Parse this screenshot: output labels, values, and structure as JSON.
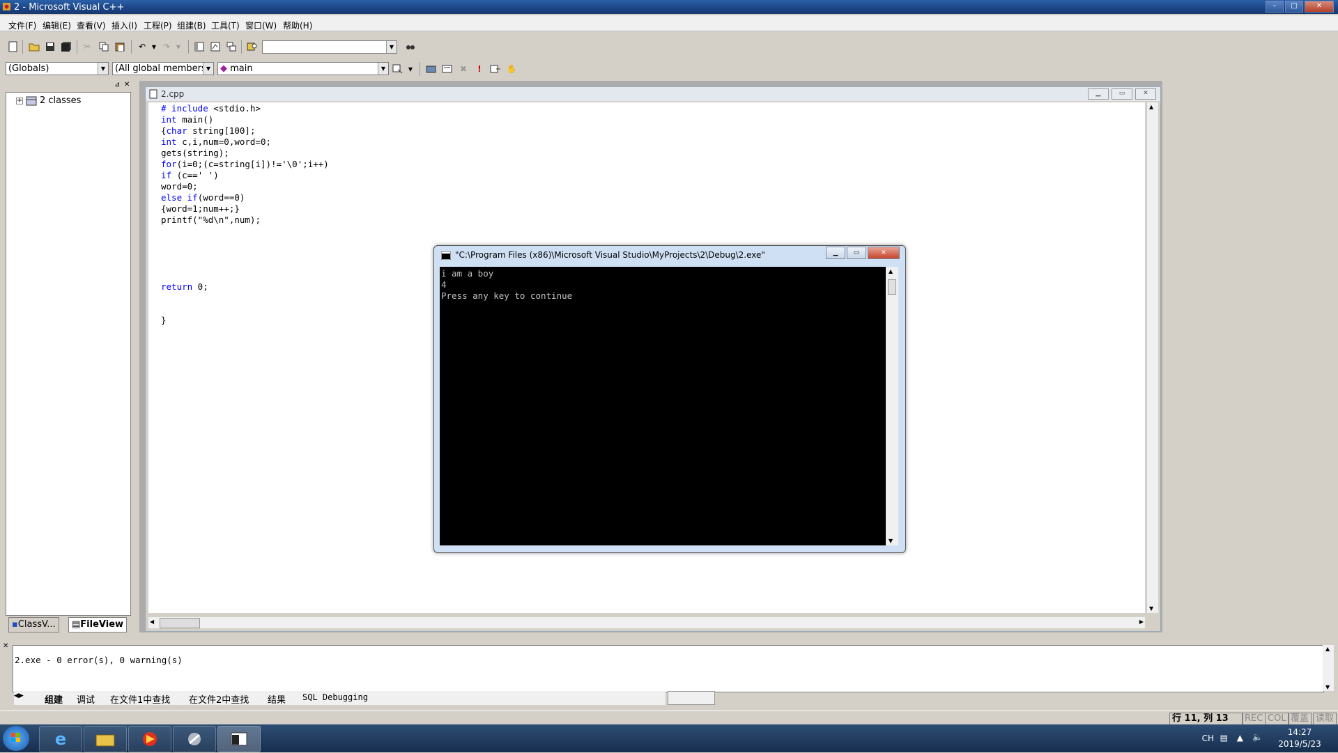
{
  "window": {
    "title": "2 - Microsoft Visual C++",
    "buttons": [
      "–",
      "□",
      "✕"
    ]
  },
  "menu": [
    "文件(F)",
    "编辑(E)",
    "查看(V)",
    "插入(I)",
    "工程(P)",
    "组建(B)",
    "工具(T)",
    "窗口(W)",
    "帮助(H)"
  ],
  "toolbar": {
    "find_combo_value": "",
    "scope_combo": "(Globals)",
    "members_combo": "(All global members",
    "function_combo": "main"
  },
  "workspace": {
    "tree_root": "2 classes",
    "tabs": [
      "ClassV...",
      "FileView"
    ]
  },
  "editor": {
    "filename": "2.cpp",
    "code_lines": [
      [
        [
          "kw",
          "# include"
        ],
        [
          "t",
          " <stdio.h>"
        ]
      ],
      [
        [
          "kw",
          "int"
        ],
        [
          "t",
          " main()"
        ]
      ],
      [
        [
          "t",
          "{"
        ],
        [
          "kw",
          "char"
        ],
        [
          "t",
          " string[100];"
        ]
      ],
      [
        [
          "kw",
          "int"
        ],
        [
          "t",
          " c,i,num=0,word=0;"
        ]
      ],
      [
        [
          "t",
          "gets(string);"
        ]
      ],
      [
        [
          "kw",
          "for"
        ],
        [
          "t",
          "(i=0;(c=string[i])!='\\0';i++)"
        ]
      ],
      [
        [
          "kw",
          "if"
        ],
        [
          "t",
          " (c==' ')"
        ]
      ],
      [
        [
          "t",
          "word=0;"
        ]
      ],
      [
        [
          "kw",
          "else if"
        ],
        [
          "t",
          "(word==0)"
        ]
      ],
      [
        [
          "t",
          "{word=1;num++;}"
        ]
      ],
      [
        [
          "t",
          "printf(\"%d\\n\",num);"
        ]
      ],
      [
        [
          "t",
          ""
        ]
      ],
      [
        [
          "t",
          ""
        ]
      ],
      [
        [
          "t",
          ""
        ]
      ],
      [
        [
          "t",
          ""
        ]
      ],
      [
        [
          "t",
          ""
        ]
      ],
      [
        [
          "kw",
          "return"
        ],
        [
          "t",
          " 0;"
        ]
      ],
      [
        [
          "t",
          ""
        ]
      ],
      [
        [
          "t",
          ""
        ]
      ],
      [
        [
          "t",
          "}"
        ]
      ]
    ]
  },
  "console": {
    "title": "\"C:\\Program Files (x86)\\Microsoft Visual Studio\\MyProjects\\2\\Debug\\2.exe\"",
    "lines": [
      "i am a boy",
      "4",
      "Press any key to continue"
    ]
  },
  "output": {
    "text": "2.exe - 0 error(s), 0 warning(s)",
    "tabs": [
      "组建",
      "调试",
      "在文件1中查找",
      "在文件2中查找",
      "结果",
      "SQL Debugging"
    ]
  },
  "status": {
    "position": "行 11, 列 13",
    "rec": "REC",
    "col": "COL",
    "ovr": "覆盖",
    "read": "读取"
  },
  "tray": {
    "lang": "CH",
    "time": "14:27",
    "date": "2019/5/23"
  }
}
